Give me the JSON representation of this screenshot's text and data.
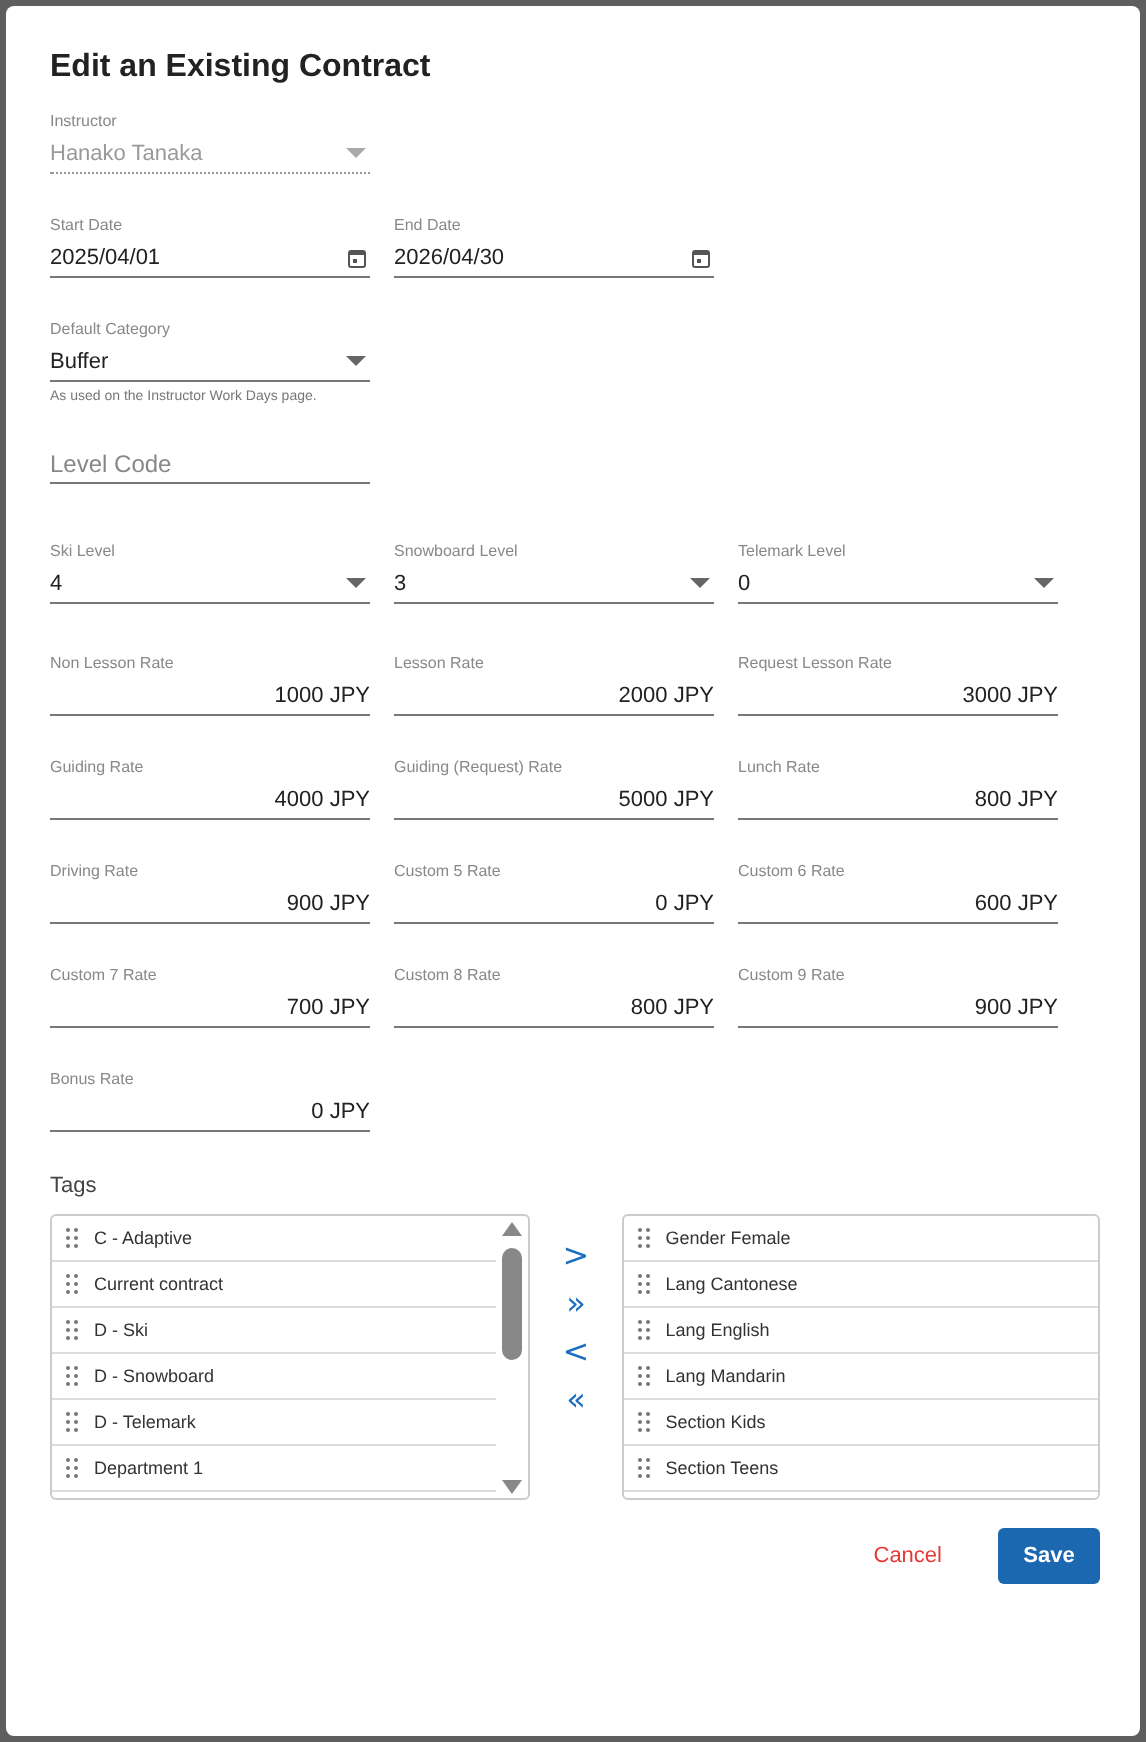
{
  "dialog": {
    "title": "Edit an Existing Contract"
  },
  "field_rows": [
    [
      {
        "kind": "select",
        "label": "Instructor",
        "value": "Hanako Tanaka",
        "disabled": true
      }
    ],
    [
      {
        "kind": "date",
        "label": "Start Date",
        "value": "2025/04/01",
        "disabled": false
      },
      {
        "kind": "date",
        "label": "End Date",
        "value": "2026/04/30",
        "disabled": false
      }
    ],
    [
      {
        "kind": "select",
        "label": "Default Category",
        "value": "Buffer",
        "hint": "As used on the Instructor Work Days page.",
        "disabled": false
      }
    ],
    [
      {
        "kind": "text",
        "placeholder": "Level Code",
        "disabled": false
      }
    ],
    [
      {
        "kind": "select",
        "label": "Ski Level",
        "value": "4",
        "disabled": false
      },
      {
        "kind": "select",
        "label": "Snowboard Level",
        "value": "3",
        "disabled": false
      },
      {
        "kind": "select",
        "label": "Telemark Level",
        "value": "0",
        "disabled": false
      }
    ],
    [
      {
        "kind": "rate",
        "label": "Non Lesson Rate",
        "value": "1000 JPY",
        "disabled": false
      },
      {
        "kind": "rate",
        "label": "Lesson Rate",
        "value": "2000 JPY",
        "disabled": false
      },
      {
        "kind": "rate",
        "label": "Request Lesson Rate",
        "value": "3000 JPY",
        "disabled": false
      }
    ],
    [
      {
        "kind": "rate",
        "label": "Guiding Rate",
        "value": "4000 JPY",
        "disabled": false
      },
      {
        "kind": "rate",
        "label": "Guiding (Request) Rate",
        "value": "5000 JPY",
        "disabled": false
      },
      {
        "kind": "rate",
        "label": "Lunch Rate",
        "value": "800 JPY",
        "disabled": false
      }
    ],
    [
      {
        "kind": "rate",
        "label": "Driving Rate",
        "value": "900 JPY",
        "disabled": false
      },
      {
        "kind": "rate",
        "label": "Custom 5 Rate",
        "value": "0 JPY",
        "disabled": false
      },
      {
        "kind": "rate",
        "label": "Custom 6 Rate",
        "value": "600 JPY",
        "disabled": false
      }
    ],
    [
      {
        "kind": "rate",
        "label": "Custom 7 Rate",
        "value": "700 JPY",
        "disabled": false
      },
      {
        "kind": "rate",
        "label": "Custom 8 Rate",
        "value": "800 JPY",
        "disabled": false
      },
      {
        "kind": "rate",
        "label": "Custom 9 Rate",
        "value": "900 JPY",
        "disabled": false
      }
    ],
    [
      {
        "kind": "rate",
        "label": "Bonus Rate",
        "value": "0 JPY",
        "disabled": false
      }
    ]
  ],
  "tags": {
    "label": "Tags",
    "available": [
      "C - Adaptive",
      "Current contract",
      "D - Ski",
      "D - Snowboard",
      "D - Telemark",
      "Department 1"
    ],
    "transfer_buttons": [
      ">",
      "»",
      "<",
      "«"
    ],
    "chosen": [
      "Gender Female",
      "Lang Cantonese",
      "Lang English",
      "Lang Mandarin",
      "Section Kids",
      "Section Teens"
    ]
  },
  "buttons": [
    {
      "kind": "text",
      "label": "Cancel"
    },
    {
      "kind": "primary",
      "label": "Save"
    }
  ]
}
